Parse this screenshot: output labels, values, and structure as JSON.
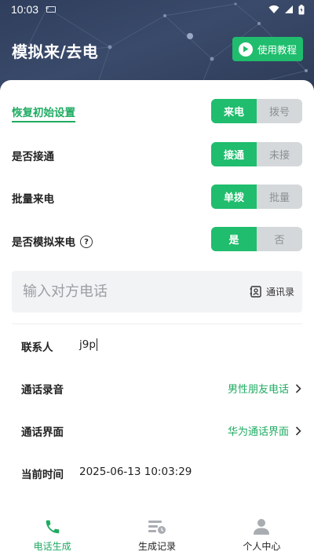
{
  "status_bar": {
    "time": "10:03"
  },
  "header": {
    "title": "模拟来/去电",
    "tutorial_label": "使用教程"
  },
  "settings": {
    "reset_label": "恢复初始设置",
    "rows": [
      {
        "label": "恢复初始设置",
        "options": [
          "来电",
          "拨号"
        ],
        "selected": 0
      },
      {
        "label": "是否接通",
        "options": [
          "接通",
          "未接"
        ],
        "selected": 0
      },
      {
        "label": "批量来电",
        "options": [
          "单拨",
          "批量"
        ],
        "selected": 0
      },
      {
        "label": "是否模拟来电",
        "options": [
          "是",
          "否"
        ],
        "selected": 0
      }
    ]
  },
  "phone_input": {
    "placeholder": "输入对方电话",
    "value": "",
    "contacts_label": "通讯录"
  },
  "info": {
    "contact": {
      "label": "联系人",
      "value": "j9p"
    },
    "recording": {
      "label": "通话录音",
      "value": "男性朋友电话"
    },
    "interface": {
      "label": "通话界面",
      "value": "华为通话界面"
    },
    "time": {
      "label": "当前时间",
      "value": "2025-06-13 10:03:29"
    }
  },
  "tabs": [
    {
      "label": "电话生成",
      "icon": "phone-icon",
      "active": true
    },
    {
      "label": "生成记录",
      "icon": "records-icon",
      "active": false
    },
    {
      "label": "个人中心",
      "icon": "user-icon",
      "active": false
    }
  ],
  "colors": {
    "accent": "#1fbd6d",
    "accent_text": "#1fab62",
    "header_bg": "#2f3e5c",
    "inactive_seg": "#d5d8da"
  }
}
